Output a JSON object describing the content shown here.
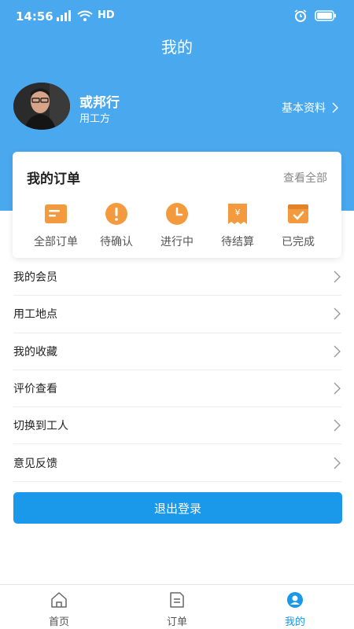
{
  "status_bar": {
    "time": "14:56",
    "network": "HD"
  },
  "header": {
    "title": "我的"
  },
  "profile": {
    "name": "或邦行",
    "role": "用工方",
    "details_link": "基本资料"
  },
  "orders": {
    "title": "我的订单",
    "view_all": "查看全部",
    "items": [
      {
        "label": "全部订单",
        "icon": "order-list-icon"
      },
      {
        "label": "待确认",
        "icon": "exclamation-icon"
      },
      {
        "label": "进行中",
        "icon": "clock-icon"
      },
      {
        "label": "待结算",
        "icon": "yen-receipt-icon"
      },
      {
        "label": "已完成",
        "icon": "check-box-icon"
      }
    ]
  },
  "menu": {
    "items": [
      {
        "label": "我的会员"
      },
      {
        "label": "用工地点"
      },
      {
        "label": "我的收藏"
      },
      {
        "label": "评价查看"
      },
      {
        "label": "切换到工人"
      },
      {
        "label": "意见反馈"
      }
    ]
  },
  "logout": {
    "label": "退出登录"
  },
  "tabbar": {
    "tabs": [
      {
        "label": "首页",
        "icon": "home-icon"
      },
      {
        "label": "订单",
        "icon": "document-icon"
      },
      {
        "label": "我的",
        "icon": "user-icon"
      }
    ],
    "active_index": 2
  },
  "colors": {
    "header_bg": "#4aa8ee",
    "accent": "#1a98ea",
    "order_icon": "#f39a3e"
  }
}
